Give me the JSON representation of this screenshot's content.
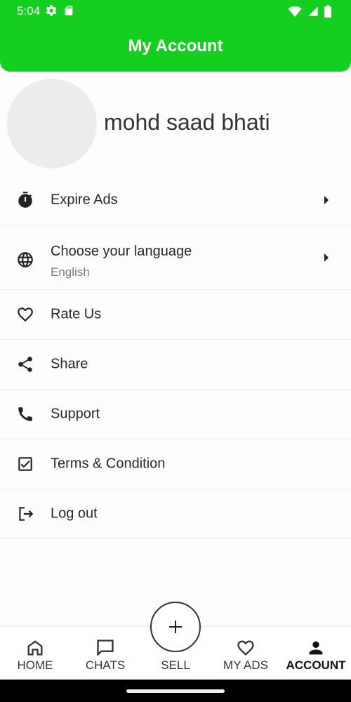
{
  "status_bar": {
    "time": "5:04",
    "left_icons": [
      "settings-gear-icon",
      "sd-card-icon"
    ],
    "right_icons": [
      "wifi-icon",
      "cellular-icon",
      "battery-icon"
    ]
  },
  "header": {
    "title": "My Account",
    "color": "#14cf1e"
  },
  "profile": {
    "name": "mohd saad bhati"
  },
  "menu": [
    {
      "label": "Expire Ads",
      "icon": "timer-icon",
      "has_chevron": true
    },
    {
      "label": "Choose your language",
      "sub": "English",
      "icon": "globe-icon",
      "has_chevron": true
    },
    {
      "label": "Rate Us",
      "icon": "heart-icon",
      "has_chevron": false
    },
    {
      "label": "Share",
      "icon": "share-icon",
      "has_chevron": false
    },
    {
      "label": "Support",
      "icon": "phone-icon",
      "has_chevron": false
    },
    {
      "label": "Terms & Condition",
      "icon": "checkbox-icon",
      "has_chevron": false
    },
    {
      "label": "Log out",
      "icon": "logout-icon",
      "has_chevron": false
    }
  ],
  "bottom_nav": {
    "items": [
      {
        "label": "HOME",
        "icon": "home-icon"
      },
      {
        "label": "CHATS",
        "icon": "chat-icon"
      },
      {
        "label": "SELL",
        "icon": "plus-icon"
      },
      {
        "label": "MY ADS",
        "icon": "heart-outline-icon"
      },
      {
        "label": "ACCOUNT",
        "icon": "person-icon",
        "active": true
      }
    ]
  }
}
